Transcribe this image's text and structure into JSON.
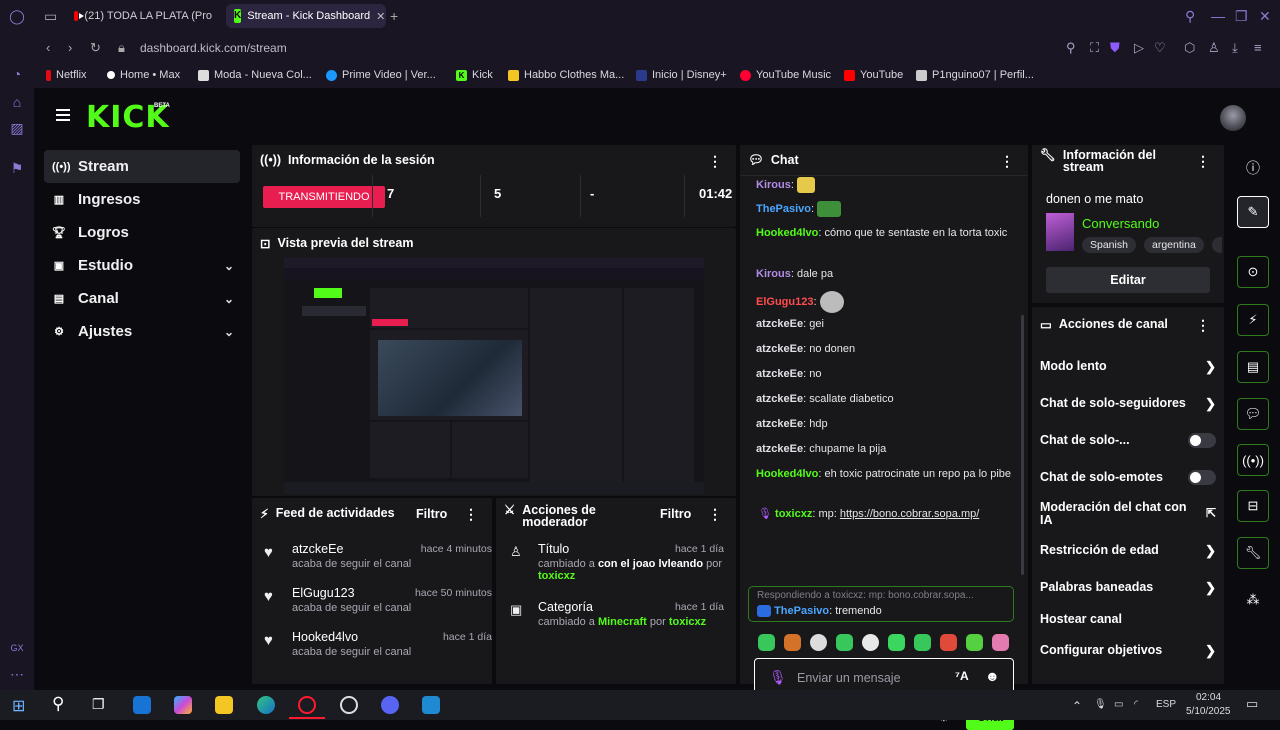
{
  "browser": {
    "tabs": [
      {
        "title": "(21) TODA LA PLATA (Pro",
        "active": false
      },
      {
        "title": "Stream - Kick Dashboard",
        "active": true
      }
    ],
    "url": "dashboard.kick.com/stream",
    "bookmarks": [
      "Netflix",
      "Home • Max",
      "Moda - Nueva Col...",
      "Prime Video | Ver...",
      "Kick",
      "Habbo Clothes Ma...",
      "Inicio | Disney+",
      "YouTube Music",
      "YouTube",
      "P1nguino07 | Perfil..."
    ]
  },
  "brand": {
    "logo": "KICK",
    "beta": "BETA",
    "accent": "#53fc18"
  },
  "sidebar": {
    "items": [
      {
        "label": "Stream",
        "active": true
      },
      {
        "label": "Ingresos"
      },
      {
        "label": "Logros"
      },
      {
        "label": "Estudio",
        "expandable": true
      },
      {
        "label": "Canal",
        "expandable": true
      },
      {
        "label": "Ajustes",
        "expandable": true
      }
    ]
  },
  "session": {
    "title": "Información de la sesión",
    "status": "TRANSMITIENDO",
    "stats": [
      "7",
      "5",
      "-",
      "01:42"
    ]
  },
  "preview": {
    "title": "Vista previa del stream"
  },
  "activity": {
    "title": "Feed de actividades",
    "filter": "Filtro",
    "items": [
      {
        "name": "atzckeEe",
        "sub": "acaba de seguir el canal",
        "time": "hace 4 minutos"
      },
      {
        "name": "ElGugu123",
        "sub": "acaba de seguir el canal",
        "time": "hace 50 minutos"
      },
      {
        "name": "Hooked4lvo",
        "sub": "acaba de seguir el canal",
        "time": "hace 1 día"
      }
    ]
  },
  "modactions": {
    "title": "Acciones de moderador",
    "filter": "Filtro",
    "items": [
      {
        "name": "Título",
        "time": "hace 1 día",
        "pre": "cambiado a ",
        "value": "con el joao lvleando",
        "by_pre": " por",
        "by": "toxicxz"
      },
      {
        "name": "Categoría",
        "time": "hace 1 día",
        "pre": "cambiado a ",
        "value": "Minecraft",
        "by_pre": " por ",
        "by": "toxicxz"
      }
    ]
  },
  "chat": {
    "title": "Chat",
    "messages": [
      {
        "user": "Kirous",
        "text": ""
      },
      {
        "user": "ThePasivo",
        "text": ""
      },
      {
        "user": "Hooked4lvo",
        "text": "cómo que te sentaste en la torta toxic"
      },
      {
        "user": "Kirous",
        "text": "dale pa"
      },
      {
        "user": "ElGugu123",
        "text": ""
      },
      {
        "user": "atzckeEe",
        "text": "gei"
      },
      {
        "user": "atzckeEe",
        "text": "no donen"
      },
      {
        "user": "atzckeEe",
        "text": "no"
      },
      {
        "user": "atzckeEe",
        "text": "scallate diabetico"
      },
      {
        "user": "atzckeEe",
        "text": "hdp"
      },
      {
        "user": "atzckeEe",
        "text": "chupame la pija"
      },
      {
        "user": "Hooked4lvo",
        "text": "eh toxic patrocinate un repo pa lo pibe"
      },
      {
        "user": "toxicxz",
        "text": "mp: ",
        "link": "https://bono.cobrar.sopa.mp/"
      }
    ],
    "reply": {
      "context": "Respondiendo a toxicxz: mp: bono.cobrar.sopa...",
      "user": "ThePasivo",
      "text": "tremendo"
    },
    "input_placeholder": "Enviar un mensaje",
    "send_label": "Chat"
  },
  "streaminfo": {
    "title": "Información del stream",
    "stream_title": "donen o me mato",
    "category": "Conversando",
    "tags": [
      "Spanish",
      "argentina"
    ],
    "edit_label": "Editar"
  },
  "channel_actions": {
    "title": "Acciones de canal",
    "items": [
      {
        "label": "Modo lento",
        "type": "arrow"
      },
      {
        "label": "Chat de solo-seguidores",
        "type": "arrow"
      },
      {
        "label": "Chat de solo-...",
        "type": "toggle"
      },
      {
        "label": "Chat de solo-emotes",
        "type": "toggle"
      },
      {
        "label": "Moderación del chat con IA",
        "type": "external"
      },
      {
        "label": "Restricción de edad",
        "type": "arrow"
      },
      {
        "label": "Palabras baneadas",
        "type": "arrow"
      },
      {
        "label": "Hostear canal",
        "type": "none"
      },
      {
        "label": "Configurar objetivos",
        "type": "arrow"
      }
    ]
  },
  "taskbar": {
    "lang": "ESP",
    "time": "02:04",
    "date": "5/10/2025"
  }
}
